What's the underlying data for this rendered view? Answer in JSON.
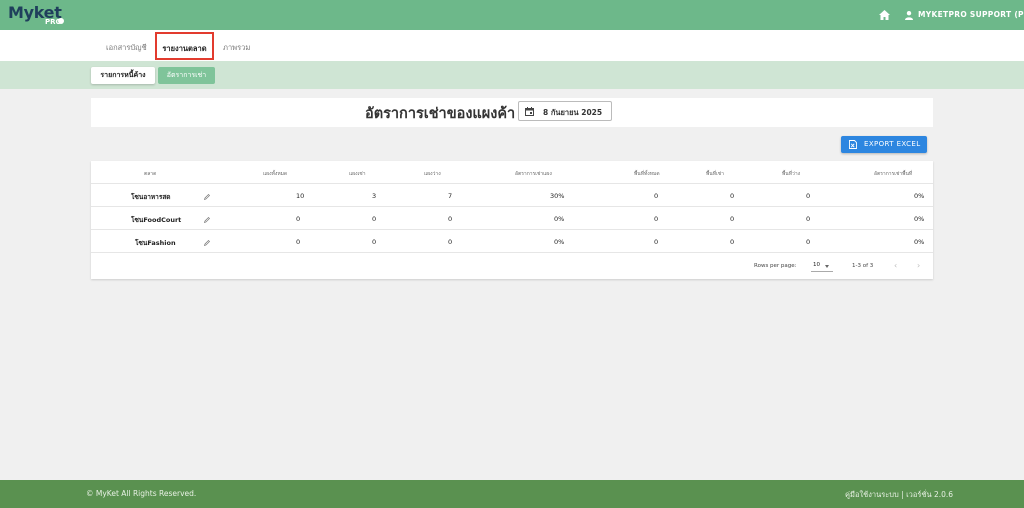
{
  "app": {
    "logo_text": "Myket",
    "logo_sub": "PRO",
    "user_name": "MYKETPRO SUPPORT (P)"
  },
  "tabs": [
    {
      "label": "เอกสารบัญชี"
    },
    {
      "label": "รายงานตลาด"
    },
    {
      "label": "ภาพรวม"
    }
  ],
  "subtabs": [
    {
      "label": "รายการหนี้ค้าง"
    },
    {
      "label": "อัตราการเช่า"
    }
  ],
  "page": {
    "title": "อัตราการเช่าของแผงค้า",
    "date": "8 กันยายน 2025",
    "export_label": "EXPORT EXCEL"
  },
  "table": {
    "headers": [
      "ตลาด",
      "แผงทั้งหมด",
      "แผงเช่า",
      "แผงว่าง",
      "อัตราการเช่าแผง",
      "พื้นที่ทั้งหมด",
      "พื้นที่เช่า",
      "พื้นที่ว่าง",
      "อัตราการเช่าพื้นที่"
    ],
    "rows": [
      [
        "โซนอาหารสด",
        "10",
        "3",
        "7",
        "30%",
        "0",
        "0",
        "0",
        "0%"
      ],
      [
        "โซนFoodCourt",
        "0",
        "0",
        "0",
        "0%",
        "0",
        "0",
        "0",
        "0%"
      ],
      [
        "โซนFashion",
        "0",
        "0",
        "0",
        "0%",
        "0",
        "0",
        "0",
        "0%"
      ]
    ]
  },
  "pagination": {
    "rows_per_page_label": "Rows per page:",
    "rows_per_page_value": "10",
    "range": "1-3 of 3"
  },
  "footer": {
    "copyright": "© MyKet All Rights Reserved.",
    "version": "คู่มือใช้งานระบบ | เวอร์ชั่น 2.0.6"
  },
  "colors": {
    "topbar": "#6db88a",
    "subbar": "#cfe5d4",
    "accent_button": "#2d86e0",
    "footer": "#5a9150",
    "highlight_border": "#e23b2e"
  }
}
